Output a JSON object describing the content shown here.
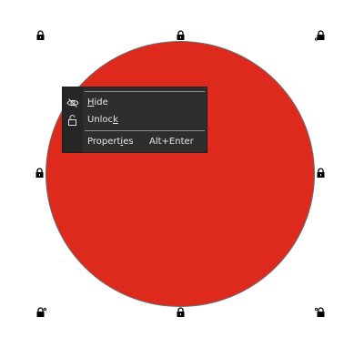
{
  "context_menu": {
    "items": [
      {
        "label": "Hide",
        "mnemonic": "H",
        "icon": "eye-slash-icon"
      },
      {
        "label": "Unlock",
        "mnemonic": "k",
        "icon": "unlock-icon"
      },
      {
        "label": "Properties",
        "mnemonic": "i",
        "shortcut": "Alt+Enter"
      }
    ]
  },
  "shape": {
    "type": "ellipse",
    "fill_color": "#dd2a1c",
    "outline_color": "#6d6d6d",
    "locked": true
  },
  "selection_handles": {
    "icon": "lock-icon",
    "corner_icon": "lock-with-rotate-icon"
  }
}
